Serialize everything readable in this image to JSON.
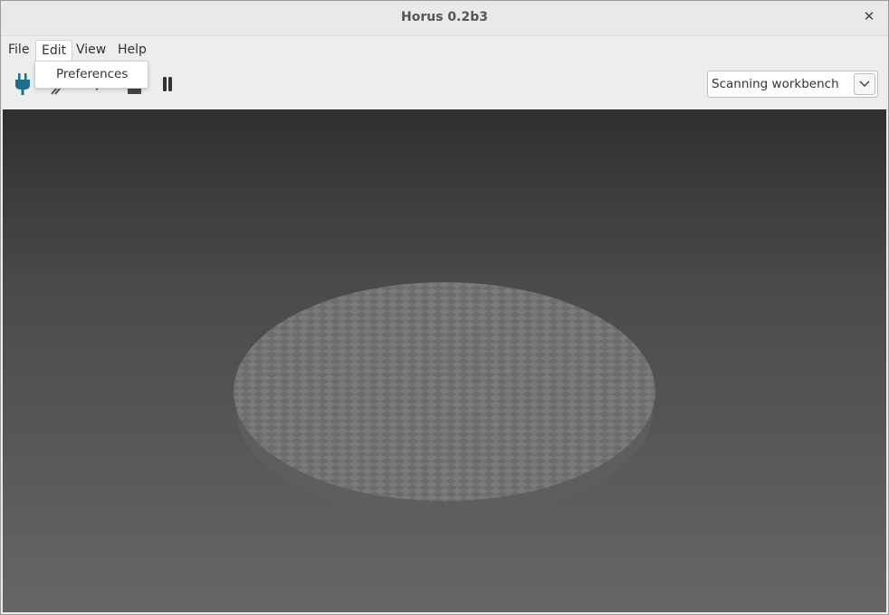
{
  "window": {
    "title": "Horus 0.2b3",
    "close_icon": "close-icon"
  },
  "menubar": {
    "items": [
      {
        "label": "File"
      },
      {
        "label": "Edit"
      },
      {
        "label": "View"
      },
      {
        "label": "Help"
      }
    ],
    "open_menu": "Edit",
    "dropdown_items": [
      {
        "label": "Preferences"
      }
    ]
  },
  "toolbar": {
    "icons": [
      "connect-plug-icon",
      "disconnect-icon",
      "play-icon",
      "stop-icon",
      "pause-icon"
    ],
    "workbench_select": {
      "value": "Scanning workbench"
    }
  },
  "colors": {
    "accent": "#1f6e8c",
    "viewport_top": "#2f2f2f",
    "viewport_bottom": "#666666",
    "platform_light": "#7a7a7a",
    "platform_dark": "#6c6c6c"
  }
}
